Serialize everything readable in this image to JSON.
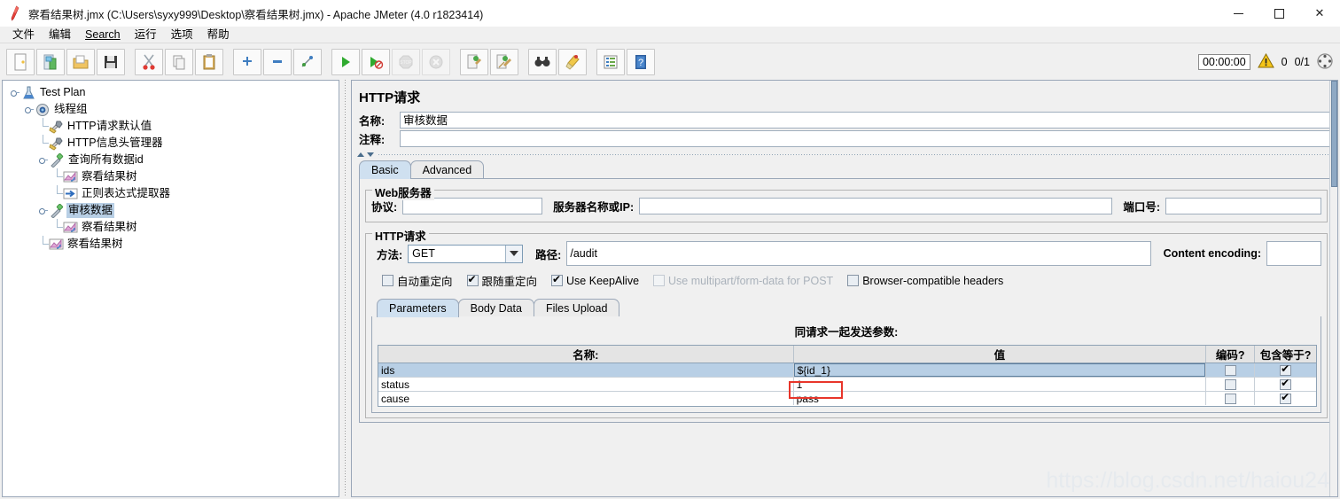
{
  "window": {
    "title": "察看结果树.jmx (C:\\Users\\syxy999\\Desktop\\察看结果树.jmx) - Apache JMeter (4.0 r1823414)",
    "app_icon": "jmeter-feather-icon",
    "minimize_label": "",
    "maximize_label": "",
    "close_label": "✕"
  },
  "menubar": {
    "items": [
      {
        "label": "文件",
        "name": "menu-file"
      },
      {
        "label": "编辑",
        "name": "menu-edit"
      },
      {
        "label": "Search",
        "name": "menu-search",
        "mnemonic": "S"
      },
      {
        "label": "运行",
        "name": "menu-run"
      },
      {
        "label": "选项",
        "name": "menu-options"
      },
      {
        "label": "帮助",
        "name": "menu-help"
      }
    ]
  },
  "toolbar": {
    "buttons": [
      {
        "name": "new-button",
        "icon": "new-document-icon",
        "enabled": true
      },
      {
        "name": "templates-button",
        "icon": "templates-icon",
        "enabled": true
      },
      {
        "name": "open-button",
        "icon": "open-folder-icon",
        "enabled": true
      },
      {
        "name": "save-button",
        "icon": "save-floppy-icon",
        "enabled": true
      },
      {
        "name": "cut-button",
        "icon": "scissors-icon",
        "enabled": true
      },
      {
        "name": "copy-button",
        "icon": "copy-icon",
        "enabled": true
      },
      {
        "name": "paste-button",
        "icon": "clipboard-paste-icon",
        "enabled": true
      },
      {
        "name": "expand-all-button",
        "icon": "plus-icon",
        "enabled": true
      },
      {
        "name": "collapse-all-button",
        "icon": "minus-icon",
        "enabled": true
      },
      {
        "name": "toggle-button",
        "icon": "toggle-icon",
        "enabled": true
      },
      {
        "name": "start-button",
        "icon": "play-green-icon",
        "enabled": true
      },
      {
        "name": "start-no-pauses-button",
        "icon": "play-no-pause-icon",
        "enabled": true
      },
      {
        "name": "stop-button",
        "icon": "stop-sign-icon",
        "enabled": false
      },
      {
        "name": "shutdown-button",
        "icon": "shutdown-icon",
        "enabled": false
      },
      {
        "name": "clear-button",
        "icon": "broom-clear-icon",
        "enabled": true
      },
      {
        "name": "clear-all-button",
        "icon": "broom-clear-all-icon",
        "enabled": true
      },
      {
        "name": "search-button",
        "icon": "binoculars-icon",
        "enabled": true
      },
      {
        "name": "search-reset-button",
        "icon": "brush-reset-icon",
        "enabled": true
      },
      {
        "name": "function-helper-button",
        "icon": "list-icon",
        "enabled": true
      },
      {
        "name": "help-button",
        "icon": "help-book-icon",
        "enabled": true
      }
    ],
    "timer": "00:00:00",
    "warning_icon": "warning-triangle-icon",
    "warning_count": "0",
    "thread_count": "0/1",
    "thread_icon": "activity-dots-icon"
  },
  "tree": {
    "nodes": [
      {
        "label": "Test Plan",
        "icon": "test-plan-icon",
        "depth": 0,
        "handle": true,
        "selected": false
      },
      {
        "label": "线程组",
        "icon": "thread-group-icon",
        "depth": 1,
        "handle": true,
        "selected": false
      },
      {
        "label": "HTTP请求默认值",
        "icon": "config-wrench-icon",
        "depth": 2,
        "handle": false,
        "selected": false
      },
      {
        "label": "HTTP信息头管理器",
        "icon": "config-wrench-icon",
        "depth": 2,
        "handle": false,
        "selected": false
      },
      {
        "label": "查询所有数据id",
        "icon": "http-sampler-icon",
        "depth": 2,
        "handle": true,
        "selected": false
      },
      {
        "label": "察看结果树",
        "icon": "view-results-tree-icon",
        "depth": 3,
        "handle": false,
        "selected": false
      },
      {
        "label": "正则表达式提取器",
        "icon": "regex-extractor-icon",
        "depth": 3,
        "handle": false,
        "selected": false
      },
      {
        "label": "审核数据",
        "icon": "http-sampler-icon",
        "depth": 2,
        "handle": true,
        "selected": true
      },
      {
        "label": "察看结果树",
        "icon": "view-results-tree-icon",
        "depth": 3,
        "handle": false,
        "selected": false
      },
      {
        "label": "察看结果树",
        "icon": "view-results-tree-icon",
        "depth": 2,
        "handle": false,
        "selected": false
      }
    ]
  },
  "editor": {
    "title": "HTTP请求",
    "name_label": "名称:",
    "name_value": "审核数据",
    "comment_label": "注释:",
    "comment_value": "",
    "main_tabs": [
      {
        "label": "Basic",
        "active": true
      },
      {
        "label": "Advanced",
        "active": false
      }
    ],
    "web_server": {
      "title": "Web服务器",
      "protocol_label": "协议:",
      "protocol_value": "",
      "server_label": "服务器名称或IP:",
      "server_value": "",
      "port_label": "端口号:",
      "port_value": ""
    },
    "http_request": {
      "title": "HTTP请求",
      "method_label": "方法:",
      "method_value": "GET",
      "path_label": "路径:",
      "path_value": "/audit",
      "content_encoding_label": "Content encoding:",
      "content_encoding_value": ""
    },
    "checkboxes": [
      {
        "label": "自动重定向",
        "checked": false,
        "enabled": true,
        "name": "auto-redirect-checkbox"
      },
      {
        "label": "跟随重定向",
        "checked": true,
        "enabled": true,
        "name": "follow-redirects-checkbox"
      },
      {
        "label": "Use KeepAlive",
        "checked": true,
        "enabled": true,
        "name": "use-keepalive-checkbox"
      },
      {
        "label": "Use multipart/form-data for POST",
        "checked": false,
        "enabled": false,
        "name": "use-multipart-checkbox"
      },
      {
        "label": "Browser-compatible headers",
        "checked": false,
        "enabled": true,
        "name": "browser-compatible-headers-checkbox"
      }
    ],
    "param_tabs": [
      {
        "label": "Parameters",
        "active": true
      },
      {
        "label": "Body Data",
        "active": false
      },
      {
        "label": "Files Upload",
        "active": false
      }
    ],
    "params_table": {
      "caption": "同请求一起发送参数:",
      "columns": [
        "名称:",
        "值",
        "编码?",
        "包含等于?"
      ],
      "rows": [
        {
          "name": "ids",
          "value": "${id_1}",
          "encode": false,
          "include_equals": true,
          "selected": true,
          "editing": true
        },
        {
          "name": "status",
          "value": "1",
          "encode": false,
          "include_equals": true,
          "selected": false,
          "editing": false
        },
        {
          "name": "cause",
          "value": "pass",
          "encode": false,
          "include_equals": true,
          "selected": false,
          "editing": false
        }
      ]
    }
  },
  "watermark": "https://blog.csdn.net/haiou24",
  "colors": {
    "selection": "#b8cfe5",
    "annotation": "#e8352a",
    "panel": "#f0f0f0",
    "border": "#9aa7b8"
  }
}
